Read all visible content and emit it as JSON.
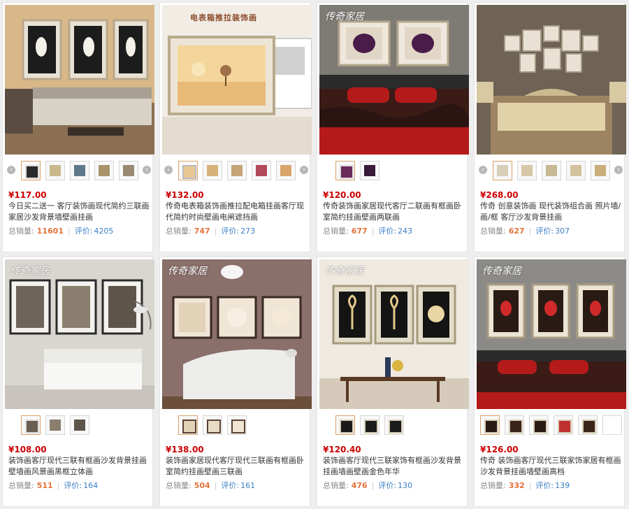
{
  "products": [
    {
      "brand": "",
      "banner": "",
      "price": "¥117.00",
      "title": "今日买二送一 客厅装饰画现代简约三联画家居沙发背景墙壁画挂画",
      "sales_label": "总销量:",
      "sales": "11601",
      "review_label": "评价:",
      "reviews": "4205"
    },
    {
      "brand": "",
      "banner": "电表箱推拉装饰画",
      "price": "¥132.00",
      "title": "传奇电表箱装饰画推拉配电箱挂画客厅现代简约时尚壁画电闸遮挡画",
      "sales_label": "总销量:",
      "sales": "747",
      "review_label": "评价:",
      "reviews": "273"
    },
    {
      "brand": "传奇家居",
      "banner": "",
      "price": "¥120.00",
      "title": "传奇装饰画家居现代客厅二联画有框画卧室简约挂画壁画两联画",
      "sales_label": "总销量:",
      "sales": "677",
      "review_label": "评价:",
      "reviews": "243"
    },
    {
      "brand": "",
      "banner": "",
      "price": "¥268.00",
      "title": "传奇 创意装饰画 现代装饰组合画 照片墙/画/框 客厅沙发背景挂画",
      "sales_label": "总销量:",
      "sales": "627",
      "review_label": "评价:",
      "reviews": "307"
    },
    {
      "brand": "传奇家居",
      "banner": "",
      "price": "¥108.00",
      "title": "装饰画客厅现代三联有框画沙发背景挂画壁墙画风景画黑框立体画",
      "sales_label": "总销量:",
      "sales": "511",
      "review_label": "评价:",
      "reviews": "164"
    },
    {
      "brand": "传奇家居",
      "banner": "",
      "price": "¥138.00",
      "title": "装饰画家居现代客厅现代三联画有框画卧室简约挂画壁画三联画",
      "sales_label": "总销量:",
      "sales": "504",
      "review_label": "评价:",
      "reviews": "161"
    },
    {
      "brand": "传奇家居",
      "banner": "",
      "price": "¥120.40",
      "title": "装饰画客厅现代三联家饰有框画沙发背景挂画墙画壁画金色年华",
      "sales_label": "总销量:",
      "sales": "476",
      "review_label": "评价:",
      "reviews": "130"
    },
    {
      "brand": "传奇家居",
      "banner": "",
      "price": "¥126.00",
      "title": "传奇 装饰画客厅现代三联家饰家居有框画沙发背景挂画墙壁画高档",
      "sales_label": "总销量:",
      "sales": "332",
      "review_label": "评价:",
      "reviews": "139"
    }
  ]
}
